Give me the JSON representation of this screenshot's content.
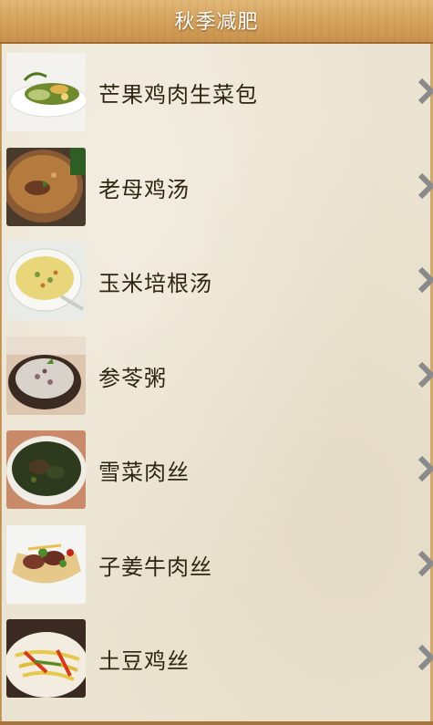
{
  "header": {
    "title": "秋季减肥"
  },
  "recipes": [
    {
      "name": "芒果鸡肉生菜包",
      "image": "mango-chicken-lettuce-wrap-photo"
    },
    {
      "name": "老母鸡汤",
      "image": "old-hen-soup-photo"
    },
    {
      "name": "玉米培根汤",
      "image": "corn-bacon-soup-photo"
    },
    {
      "name": "参苓粥",
      "image": "shenling-porridge-photo"
    },
    {
      "name": "雪菜肉丝",
      "image": "pickled-greens-shredded-pork-photo"
    },
    {
      "name": "子姜牛肉丝",
      "image": "ginger-beef-strips-photo"
    },
    {
      "name": "土豆鸡丝",
      "image": "potato-chicken-strips-photo"
    }
  ],
  "colors": {
    "header_wood": "#d6a560",
    "panel_bg": "#ece4d2",
    "label_text": "#2e2611",
    "chevron": "#8a8a8a"
  },
  "icons": {
    "row_arrow": "chevron-right-icon"
  }
}
